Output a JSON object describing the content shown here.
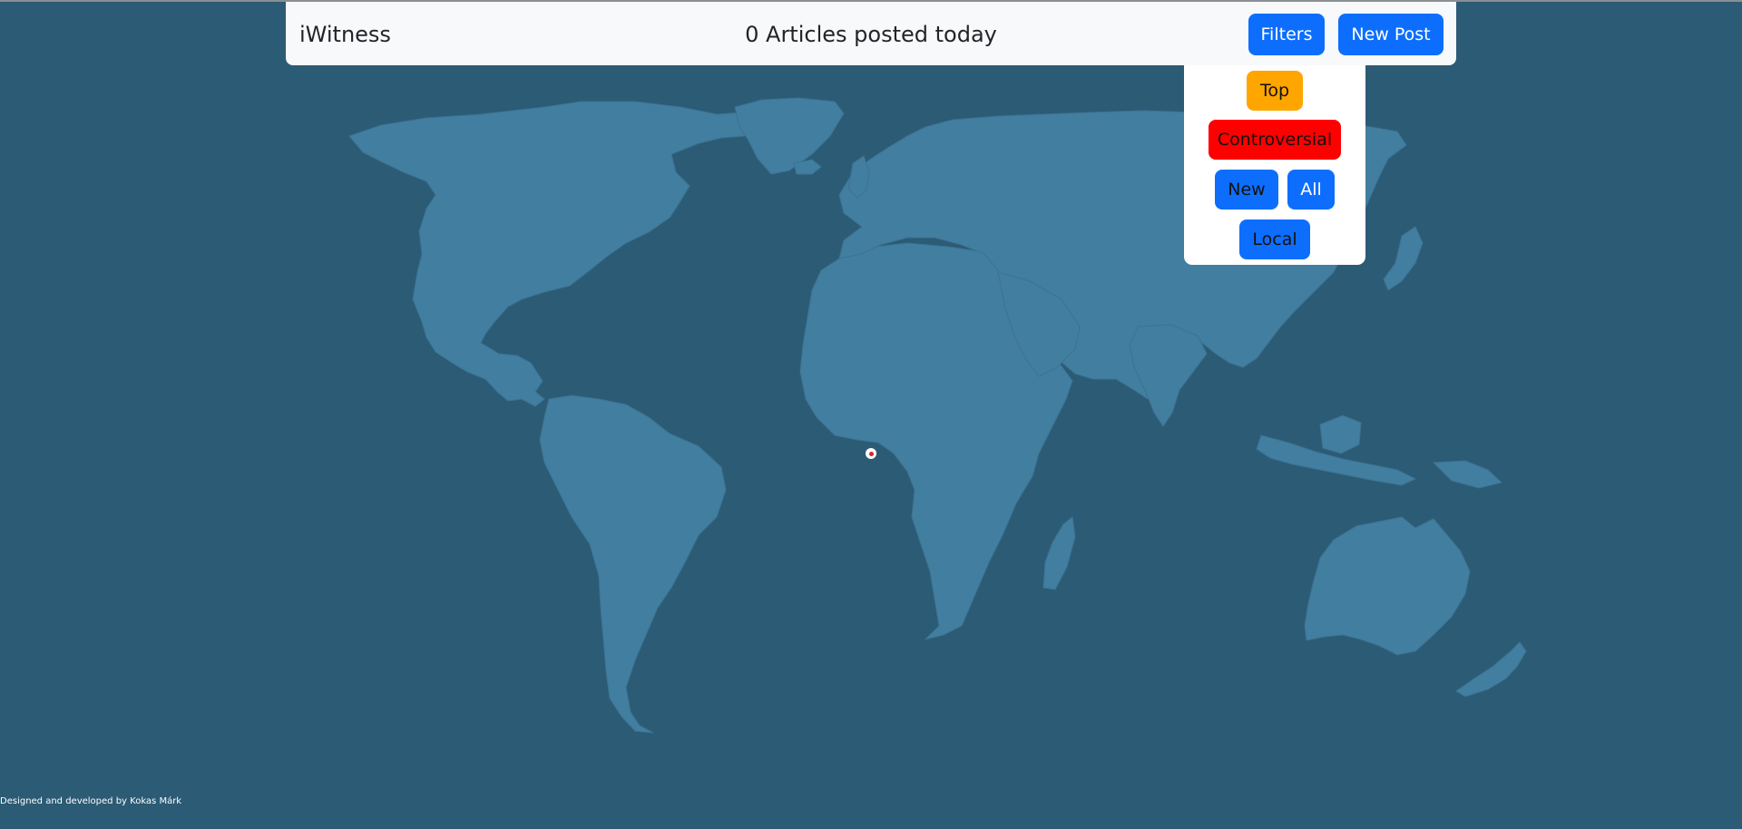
{
  "navbar": {
    "brand": "iWitness",
    "article_count_text": "0 Articles posted today",
    "filters_label": "Filters",
    "new_post_label": "New Post"
  },
  "filters_menu": {
    "top_label": "Top",
    "controversial_label": "Controversial",
    "new_label": "New",
    "all_label": "All",
    "local_label": "Local"
  },
  "map": {
    "ocean_color": "#2c5b75",
    "land_color": "#427e9f",
    "marker_count": 1
  },
  "footer": {
    "credit": "Designed and developed by Kokas Márk"
  },
  "colors": {
    "primary": "#0d6efd",
    "top": "#ffa500",
    "controversial": "#ff0000",
    "navbar_bg": "#f8f9fa"
  }
}
